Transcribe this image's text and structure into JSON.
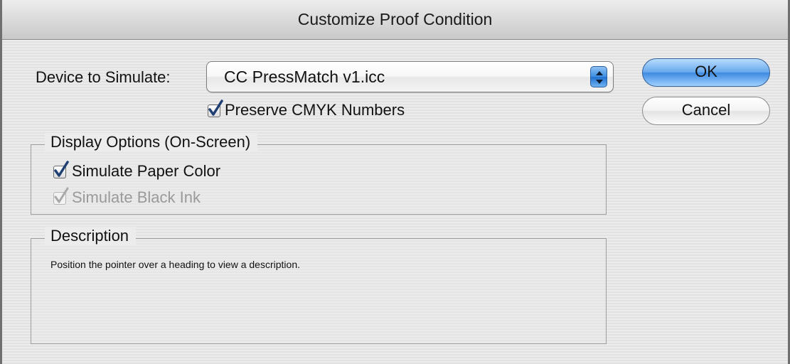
{
  "window": {
    "title": "Customize Proof Condition"
  },
  "device": {
    "label": "Device to Simulate:",
    "selected": "CC PressMatch v1.icc"
  },
  "preserve_cmyk": {
    "label": "Preserve CMYK Numbers",
    "checked": true
  },
  "buttons": {
    "ok": "OK",
    "cancel": "Cancel"
  },
  "display_options": {
    "title": "Display Options (On-Screen)",
    "simulate_paper_color": {
      "label": "Simulate Paper Color",
      "checked": true,
      "enabled": true
    },
    "simulate_black_ink": {
      "label": "Simulate Black Ink",
      "checked": true,
      "enabled": false
    }
  },
  "description": {
    "title": "Description",
    "text": "Position the pointer over a heading to view a description."
  },
  "colors": {
    "accent_blue": "#3f8be1",
    "checkmark": "#1f3f73",
    "disabled_text": "#9a9a9a"
  }
}
